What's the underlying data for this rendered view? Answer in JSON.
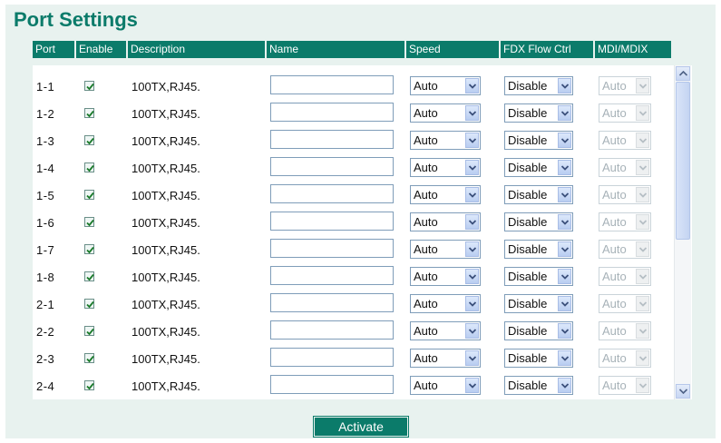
{
  "page": {
    "title": "Port Settings",
    "accent_color": "#0b7b6a"
  },
  "table": {
    "columns": [
      "Port",
      "Enable",
      "Description",
      "Name",
      "Speed",
      "FDX Flow Ctrl",
      "MDI/MDIX"
    ],
    "rows": [
      {
        "port": "1-1",
        "enabled": true,
        "description": "100TX,RJ45.",
        "name": "",
        "speed": "Auto",
        "fdx": "Disable",
        "mdi": "Auto"
      },
      {
        "port": "1-2",
        "enabled": true,
        "description": "100TX,RJ45.",
        "name": "",
        "speed": "Auto",
        "fdx": "Disable",
        "mdi": "Auto"
      },
      {
        "port": "1-3",
        "enabled": true,
        "description": "100TX,RJ45.",
        "name": "",
        "speed": "Auto",
        "fdx": "Disable",
        "mdi": "Auto"
      },
      {
        "port": "1-4",
        "enabled": true,
        "description": "100TX,RJ45.",
        "name": "",
        "speed": "Auto",
        "fdx": "Disable",
        "mdi": "Auto"
      },
      {
        "port": "1-5",
        "enabled": true,
        "description": "100TX,RJ45.",
        "name": "",
        "speed": "Auto",
        "fdx": "Disable",
        "mdi": "Auto"
      },
      {
        "port": "1-6",
        "enabled": true,
        "description": "100TX,RJ45.",
        "name": "",
        "speed": "Auto",
        "fdx": "Disable",
        "mdi": "Auto"
      },
      {
        "port": "1-7",
        "enabled": true,
        "description": "100TX,RJ45.",
        "name": "",
        "speed": "Auto",
        "fdx": "Disable",
        "mdi": "Auto"
      },
      {
        "port": "1-8",
        "enabled": true,
        "description": "100TX,RJ45.",
        "name": "",
        "speed": "Auto",
        "fdx": "Disable",
        "mdi": "Auto"
      },
      {
        "port": "2-1",
        "enabled": true,
        "description": "100TX,RJ45.",
        "name": "",
        "speed": "Auto",
        "fdx": "Disable",
        "mdi": "Auto"
      },
      {
        "port": "2-2",
        "enabled": true,
        "description": "100TX,RJ45.",
        "name": "",
        "speed": "Auto",
        "fdx": "Disable",
        "mdi": "Auto"
      },
      {
        "port": "2-3",
        "enabled": true,
        "description": "100TX,RJ45.",
        "name": "",
        "speed": "Auto",
        "fdx": "Disable",
        "mdi": "Auto"
      },
      {
        "port": "2-4",
        "enabled": true,
        "description": "100TX,RJ45.",
        "name": "",
        "speed": "Auto",
        "fdx": "Disable",
        "mdi": "Auto"
      }
    ]
  },
  "actions": {
    "activate_label": "Activate"
  }
}
